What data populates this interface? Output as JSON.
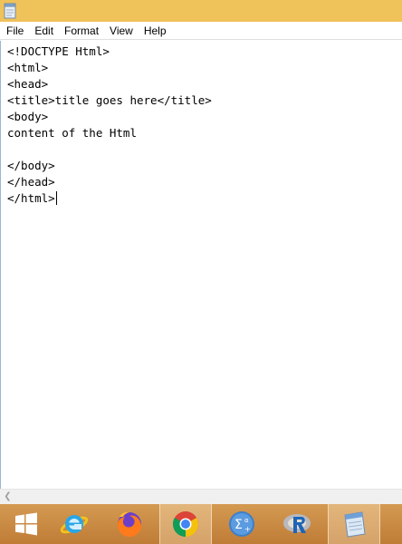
{
  "menu": {
    "file": "File",
    "edit": "Edit",
    "format": "Format",
    "view": "View",
    "help": "Help"
  },
  "editor": {
    "lines": [
      "<!DOCTYPE Html>",
      "<html>",
      "<head>",
      "<title>title goes here</title>",
      "<body>",
      "content of the Html",
      "",
      "</body>",
      "</head>",
      "</html>"
    ]
  },
  "taskbar": {
    "icons": [
      "windows-start-icon",
      "internet-explorer-icon",
      "firefox-icon",
      "chrome-icon",
      "sigma-app-icon",
      "r-icon",
      "notepad-icon"
    ]
  },
  "colors": {
    "titlebar": "#f0c25a",
    "taskbar": "#c98a43"
  }
}
